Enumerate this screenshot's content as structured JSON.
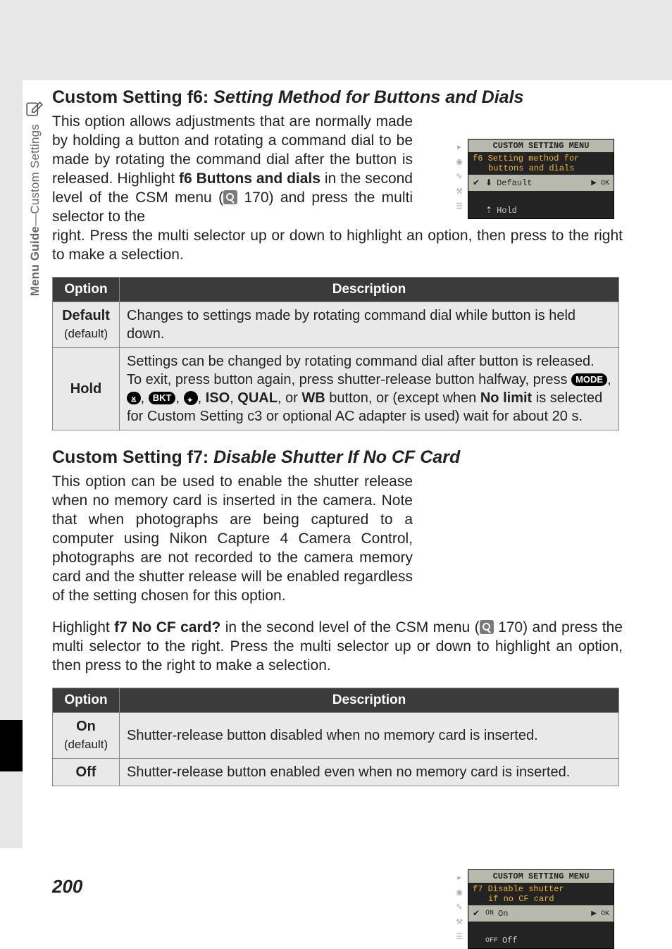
{
  "page_number": "200",
  "sidebar": {
    "label_bold": "Menu Guide",
    "label_sep": "—",
    "label_rest": "Custom Settings"
  },
  "f6": {
    "heading_prefix": "Custom Setting f6: ",
    "heading_italic": "Setting Method for Buttons and Dials",
    "para1_part1": "This option allows adjustments that are normally made by holding a button and rotating a command dial to be made by rotating the command dial after the button is released.  Highlight ",
    "para1_bold1": "f6 Buttons and dials",
    "para1_part2": " in the second level of the CSM menu (",
    "para1_pageref": " 170) and press the multi selector to the ",
    "para2": "right.  Press the multi selector up or down to highlight an option, then press to the right to make a selection.",
    "th_option": "Option",
    "th_desc": "Description",
    "row1_opt_main": "Default",
    "row1_opt_sub": "(default)",
    "row1_desc": "Changes to settings made by rotating command dial while button is held down.",
    "row2_opt_main": "Hold",
    "row2_desc_part1": "Settings can be changed by rotating command dial after button is released. To exit, press button again, press shutter-release button halfway, press ",
    "row2_desc_part2": ", ",
    "row2_desc_iso": "ISO",
    "row2_desc_qual": "QUAL",
    "row2_desc_or": ", or ",
    "row2_desc_wb": "WB",
    "row2_desc_part3": " button, or (except when ",
    "row2_desc_nolimit": "No limit",
    "row2_desc_part4": " is selected for Custom Setting c3 or optional AC adapter is used) wait for about 20 s.",
    "lcd": {
      "title": "CUSTOM SETTING MENU",
      "sub1": "f6  Setting method for",
      "sub2": "buttons and dials",
      "row_default": "Default",
      "row_hold": "Hold",
      "ok": "▶ OK"
    }
  },
  "f7": {
    "heading_prefix": "Custom Setting f7: ",
    "heading_italic": "Disable Shutter If No CF Card",
    "para1": "This option can be used to enable the shutter release when no memory card is inserted in the camera.  Note that when photographs are being captured to a computer using Nikon Capture 4 Camera Control, photographs are not recorded to the camera memory card and the shutter release will be enabled regardless of the setting chosen for this option.",
    "para2_part1": "Highlight ",
    "para2_bold": "f7 No CF card?",
    "para2_part2": " in the second level of the CSM menu (",
    "para2_pageref": " 170) and press the multi selector to the right.  Press the multi selector up or down to highlight an option, then press to the right to make a selection.",
    "th_option": "Option",
    "th_desc": "Description",
    "row1_opt_main": "On",
    "row1_opt_sub": "(default)",
    "row1_desc": "Shutter-release button disabled when no memory card is inserted.",
    "row2_opt_main": "Off",
    "row2_desc": "Shutter-release button enabled even when no memory card is inserted.",
    "lcd": {
      "title": "CUSTOM SETTING MENU",
      "sub1": "f7  Disable shutter",
      "sub2": "if no CF card",
      "row_on_label": "ON",
      "row_on": "On",
      "row_off_label": "OFF",
      "row_off": "Off",
      "ok": "▶ OK"
    }
  }
}
